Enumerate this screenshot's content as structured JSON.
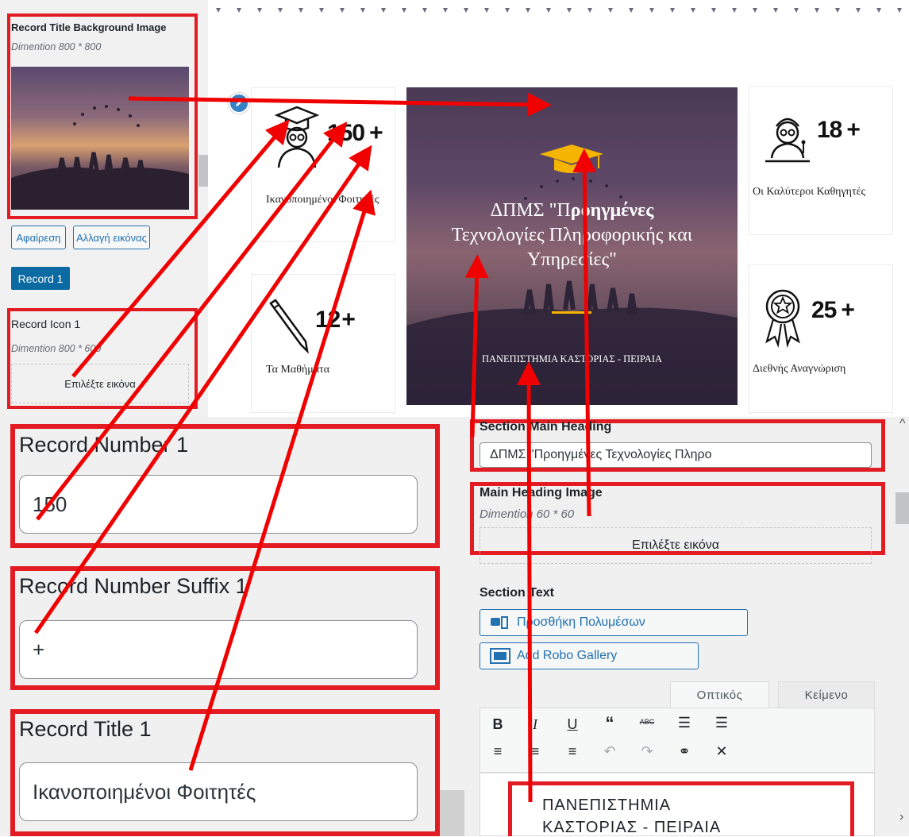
{
  "admin_top": {
    "bg_image_label": "Record Title Background Image",
    "bg_image_dimension": "Dimention 800 * 800",
    "remove_button": "Αφαίρεση",
    "change_image_button": "Αλλαγή εικόνας",
    "record_tab": "Record 1",
    "icon_label": "Record Icon 1",
    "icon_dimension": "Dimention 800 * 600",
    "select_image": "Επιλέξτε εικόνα"
  },
  "preview": {
    "stats": [
      {
        "number": "150",
        "suffix": "+",
        "label": "Ικανοποιημένοι Φοιτητές",
        "icon": "graduate-icon"
      },
      {
        "number": "12",
        "suffix": "+",
        "label": "Τα Μαθήματα",
        "icon": "pencil-icon"
      },
      {
        "number": "18",
        "suffix": "+",
        "label": "Οι Καλύτεροι Καθηγητές",
        "icon": "teacher-icon"
      },
      {
        "number": "25",
        "suffix": "+",
        "label": "Διεθνής Αναγνώριση",
        "icon": "award-icon"
      }
    ],
    "hero_title_part1": "ΔΠΜΣ \"Π",
    "hero_title_bold": "ροηγμένες",
    "hero_title_part2": "Τεχνολογίες Πληροφορικής και Υπηρεσίες\"",
    "hero_subtitle": "ΠΑΝΕΠΙΣΤΗΜΙΑ ΚΑΣΤΟΡΙΑΣ - ΠΕΙΡΑΙΑ",
    "hero_icon": "graduation-cap-icon"
  },
  "fields": {
    "number_label": "Record Number 1",
    "number_value": "150",
    "suffix_label": "Record Number Suffix 1",
    "suffix_value": "+",
    "title_label": "Record Title 1",
    "title_value": "Ικανοποιημένοι Φοιτητές"
  },
  "customizer": {
    "main_heading_label": "Section Main Heading",
    "main_heading_value": "ΔΠΜΣ \"Προηγμένες Τεχνολογίες Πληρο",
    "main_heading_image_label": "Main Heading Image",
    "main_heading_image_dimension": "Dimention 60 * 60",
    "select_image": "Επιλέξτε εικόνα",
    "section_text_label": "Section Text",
    "add_media_button": "Προσθήκη Πολυμέσων",
    "add_gallery_button": "Add Robo Gallery",
    "tab_visual": "Οπτικός",
    "tab_text": "Κείμενο",
    "editor_line1": "ΠΑΝΕΠΙΣΤΗΜΙΑ",
    "editor_line2": "ΚΑΣΤΟΡΙΑΣ - ΠΕΙΡΑΙΑ"
  },
  "colors": {
    "highlight": "#e31b23",
    "wp_blue": "#2271b1",
    "hero_accent": "#f5b400"
  }
}
